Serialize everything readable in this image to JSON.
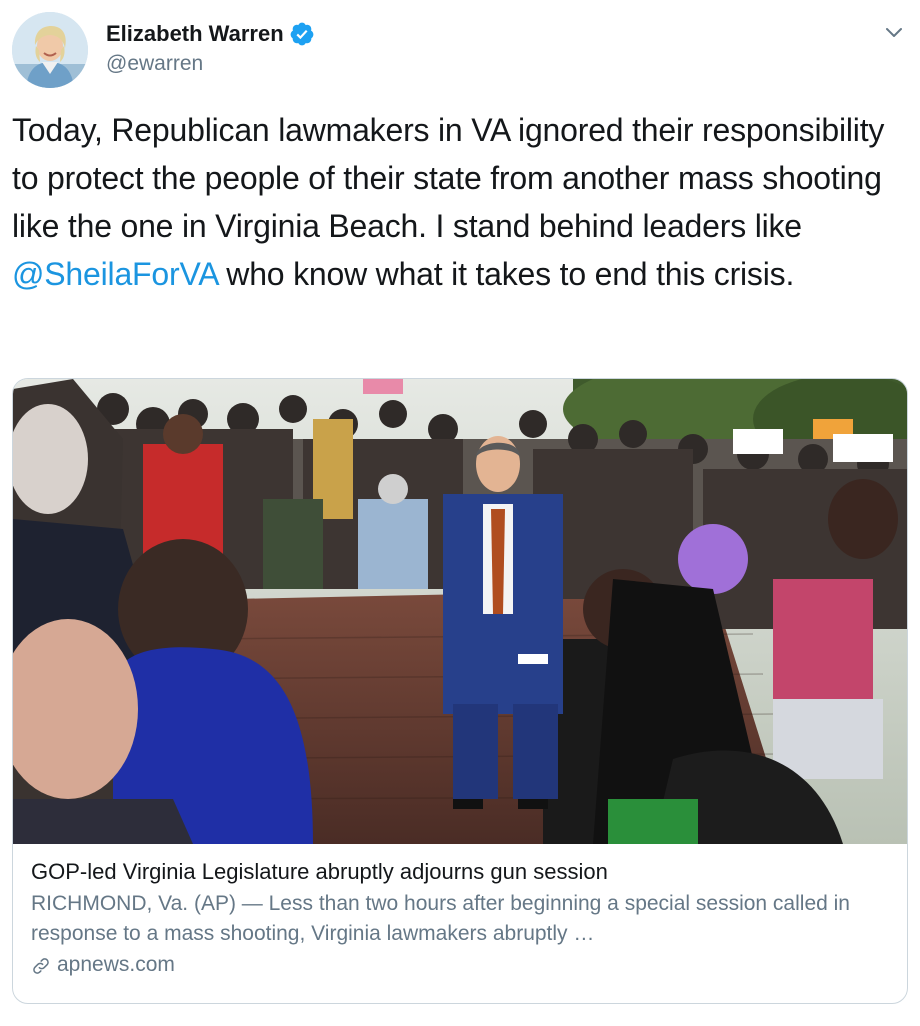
{
  "author": {
    "name": "Elizabeth Warren",
    "handle": "@ewarren",
    "verified": true
  },
  "tweet": {
    "text_before": "Today, Republican lawmakers in VA ignored their responsibility to protect the people of their state from another mass shooting like the one in Virginia Beach. I stand behind leaders like ",
    "mention": "@SheilaForVA",
    "text_after": " who know what it takes to end this crisis."
  },
  "card": {
    "title": "GOP-led Virginia Legislature abruptly adjourns gun session",
    "description": "RICHMOND, Va. (AP) — Less than two hours after beginning a special session called in response to a mass shooting, Virginia lawmakers abruptly …",
    "domain": "apnews.com"
  },
  "icons": {
    "verified": "verified-badge-icon",
    "menu": "chevron-down-icon",
    "link": "link-icon"
  },
  "colors": {
    "link_blue": "#1b95e0",
    "verified_blue": "#1da1f2",
    "secondary_text": "#657786",
    "border": "#ccd6dd"
  }
}
